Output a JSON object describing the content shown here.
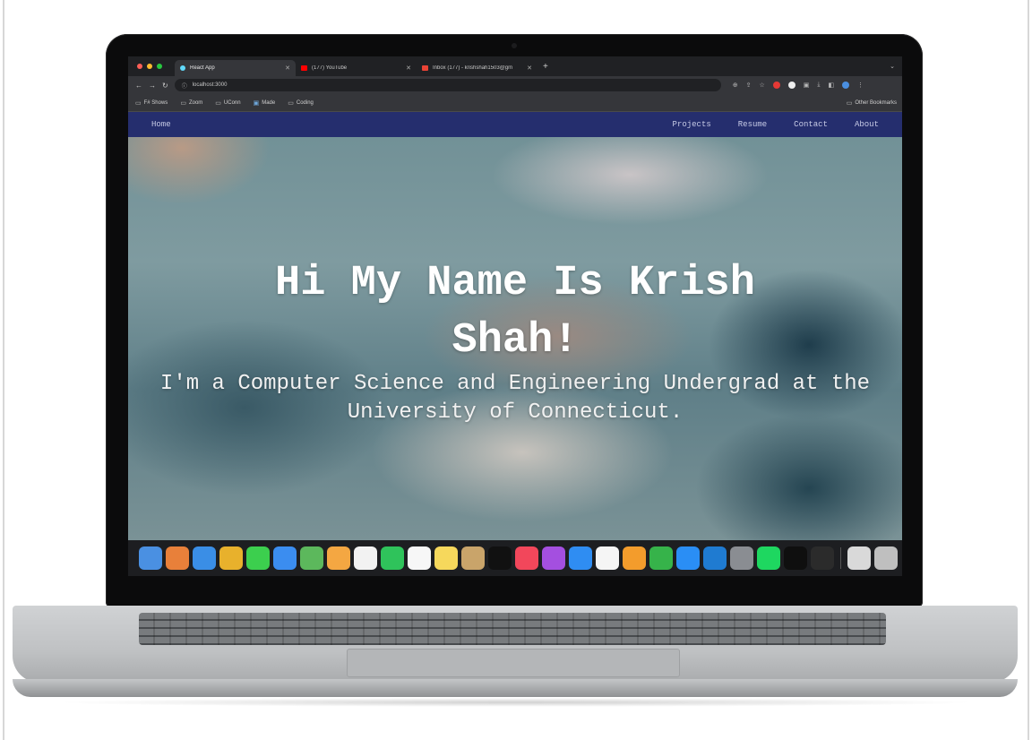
{
  "browser": {
    "tabs": [
      {
        "title": "React App",
        "active": true,
        "icon_color": "#61dafb"
      },
      {
        "title": "(177) YouTube",
        "active": false,
        "icon_color": "#ff0000"
      },
      {
        "title": "Inbox (177) - krishshah1503@gm",
        "active": false,
        "icon_color": "#ea4335"
      }
    ],
    "new_tab": "+",
    "tab_menu": "⌄",
    "address": "localhost:3000",
    "bookmarks": [
      "F# Shows",
      "Zoom",
      "UConn",
      "Made",
      "Coding"
    ],
    "other_bookmarks": "Other Bookmarks"
  },
  "site": {
    "nav_home": "Home",
    "nav_links": [
      "Projects",
      "Resume",
      "Contact",
      "About"
    ],
    "hero_title": "Hi My Name Is Krish Shah!",
    "hero_subtitle": "I'm a Computer Science and Engineering Undergrad at the University of Connecticut."
  },
  "dock": {
    "apps": [
      {
        "name": "finder",
        "color": "#4a90e2"
      },
      {
        "name": "launchpad",
        "color": "#e8803a"
      },
      {
        "name": "safari",
        "color": "#3a8ee6"
      },
      {
        "name": "chrome",
        "color": "#e8b12c"
      },
      {
        "name": "messages",
        "color": "#3ccf4e"
      },
      {
        "name": "mail",
        "color": "#3b8df0"
      },
      {
        "name": "maps",
        "color": "#5cb85c"
      },
      {
        "name": "photos",
        "color": "#f4a742"
      },
      {
        "name": "calendar",
        "color": "#f2f2f2"
      },
      {
        "name": "facetime",
        "color": "#2fc35b"
      },
      {
        "name": "reminders",
        "color": "#f7f7f7"
      },
      {
        "name": "notes",
        "color": "#f6d85c"
      },
      {
        "name": "contacts",
        "color": "#c9a46a"
      },
      {
        "name": "apple-tv",
        "color": "#111111"
      },
      {
        "name": "music",
        "color": "#f2475b"
      },
      {
        "name": "podcasts",
        "color": "#a44fe0"
      },
      {
        "name": "keynote",
        "color": "#2f8df2"
      },
      {
        "name": "news",
        "color": "#f5f5f5"
      },
      {
        "name": "pages",
        "color": "#f39c2c"
      },
      {
        "name": "numbers",
        "color": "#36b34a"
      },
      {
        "name": "app-store",
        "color": "#2a8ef5"
      },
      {
        "name": "vscode",
        "color": "#1f7bd1"
      },
      {
        "name": "system-preferences",
        "color": "#8a8d92"
      },
      {
        "name": "spotify",
        "color": "#1ed760"
      },
      {
        "name": "pycharm",
        "color": "#0f0f0f"
      },
      {
        "name": "terminal",
        "color": "#2b2b2b"
      }
    ],
    "trailing": [
      {
        "name": "screen-preview",
        "color": "#d9d9d9"
      },
      {
        "name": "trash",
        "color": "#bfbfbf"
      }
    ]
  }
}
